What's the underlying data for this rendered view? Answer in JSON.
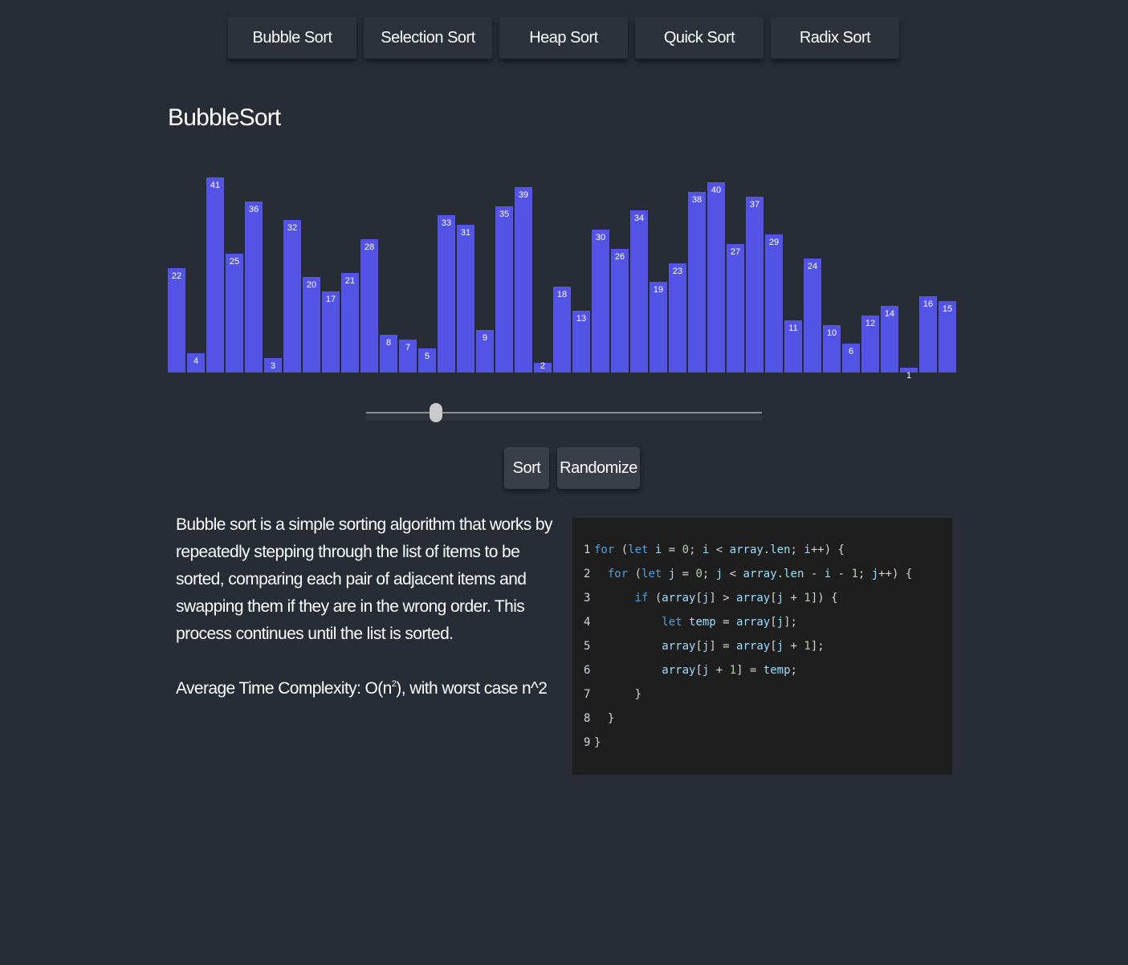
{
  "nav": {
    "items": [
      {
        "label": "Bubble Sort"
      },
      {
        "label": "Selection Sort"
      },
      {
        "label": "Heap Sort"
      },
      {
        "label": "Quick Sort"
      },
      {
        "label": "Radix Sort"
      }
    ]
  },
  "visualizer": {
    "title": "BubbleSort",
    "bar_color": "#5353e6",
    "values": [
      22,
      4,
      41,
      25,
      36,
      3,
      32,
      20,
      17,
      21,
      28,
      8,
      7,
      5,
      33,
      31,
      9,
      35,
      39,
      2,
      18,
      13,
      30,
      26,
      34,
      19,
      23,
      38,
      40,
      27,
      37,
      29,
      11,
      24,
      10,
      6,
      12,
      14,
      1,
      16,
      15
    ],
    "max_value": 41
  },
  "slider": {
    "value_fraction": 0.177
  },
  "actions": {
    "sort_label": "Sort",
    "randomize_label": "Randomize"
  },
  "description": {
    "text": "Bubble sort is a simple sorting algorithm that works by repeatedly stepping through the list of items to be sorted, comparing each pair of adjacent items and swapping them if they are in the wrong order. This process continues until the list is sorted.",
    "complexity_prefix": "Average Time Complexity: O(n",
    "complexity_sup": "2",
    "complexity_suffix": "), with worst case n^2"
  },
  "code": {
    "lines": [
      {
        "num": "1",
        "indent": "",
        "tokens": [
          [
            "kw",
            "for"
          ],
          [
            "p",
            " ("
          ],
          [
            "kw",
            "let"
          ],
          [
            "p",
            " "
          ],
          [
            "var",
            "i"
          ],
          [
            "p",
            " = "
          ],
          [
            "num",
            "0"
          ],
          [
            "p",
            "; "
          ],
          [
            "var",
            "i"
          ],
          [
            "p",
            " < "
          ],
          [
            "var",
            "array"
          ],
          [
            "p",
            "."
          ],
          [
            "var",
            "len"
          ],
          [
            "p",
            "; "
          ],
          [
            "var",
            "i"
          ],
          [
            "p",
            "++) {"
          ]
        ]
      },
      {
        "num": "2",
        "indent": "  ",
        "tokens": [
          [
            "kw",
            "for"
          ],
          [
            "p",
            " ("
          ],
          [
            "kw",
            "let"
          ],
          [
            "p",
            " "
          ],
          [
            "var",
            "j"
          ],
          [
            "p",
            " = "
          ],
          [
            "num",
            "0"
          ],
          [
            "p",
            "; "
          ],
          [
            "var",
            "j"
          ],
          [
            "p",
            " < "
          ],
          [
            "var",
            "array"
          ],
          [
            "p",
            "."
          ],
          [
            "var",
            "len"
          ],
          [
            "p",
            " - "
          ],
          [
            "var",
            "i"
          ],
          [
            "p",
            " - "
          ],
          [
            "num",
            "1"
          ],
          [
            "p",
            "; "
          ],
          [
            "var",
            "j"
          ],
          [
            "p",
            "++) {"
          ]
        ]
      },
      {
        "num": "3",
        "indent": "      ",
        "tokens": [
          [
            "kw",
            "if"
          ],
          [
            "p",
            " ("
          ],
          [
            "var",
            "array"
          ],
          [
            "p",
            "["
          ],
          [
            "var",
            "j"
          ],
          [
            "p",
            "] > "
          ],
          [
            "var",
            "array"
          ],
          [
            "p",
            "["
          ],
          [
            "var",
            "j"
          ],
          [
            "p",
            " + "
          ],
          [
            "num",
            "1"
          ],
          [
            "p",
            "]) {"
          ]
        ]
      },
      {
        "num": "4",
        "indent": "          ",
        "tokens": [
          [
            "kw",
            "let"
          ],
          [
            "p",
            " "
          ],
          [
            "var",
            "temp"
          ],
          [
            "p",
            " = "
          ],
          [
            "var",
            "array"
          ],
          [
            "p",
            "["
          ],
          [
            "var",
            "j"
          ],
          [
            "p",
            "];"
          ]
        ]
      },
      {
        "num": "5",
        "indent": "          ",
        "tokens": [
          [
            "var",
            "array"
          ],
          [
            "p",
            "["
          ],
          [
            "var",
            "j"
          ],
          [
            "p",
            "] = "
          ],
          [
            "var",
            "array"
          ],
          [
            "p",
            "["
          ],
          [
            "var",
            "j"
          ],
          [
            "p",
            " + "
          ],
          [
            "num",
            "1"
          ],
          [
            "p",
            "];"
          ]
        ]
      },
      {
        "num": "6",
        "indent": "          ",
        "tokens": [
          [
            "var",
            "array"
          ],
          [
            "p",
            "["
          ],
          [
            "var",
            "j"
          ],
          [
            "p",
            " + "
          ],
          [
            "num",
            "1"
          ],
          [
            "p",
            "] = "
          ],
          [
            "var",
            "temp"
          ],
          [
            "p",
            ";"
          ]
        ]
      },
      {
        "num": "7",
        "indent": "      ",
        "tokens": [
          [
            "p",
            "}"
          ]
        ]
      },
      {
        "num": "8",
        "indent": "  ",
        "tokens": [
          [
            "p",
            "}"
          ]
        ]
      },
      {
        "num": "9",
        "indent": "",
        "tokens": [
          [
            "p",
            "}"
          ]
        ]
      }
    ]
  }
}
